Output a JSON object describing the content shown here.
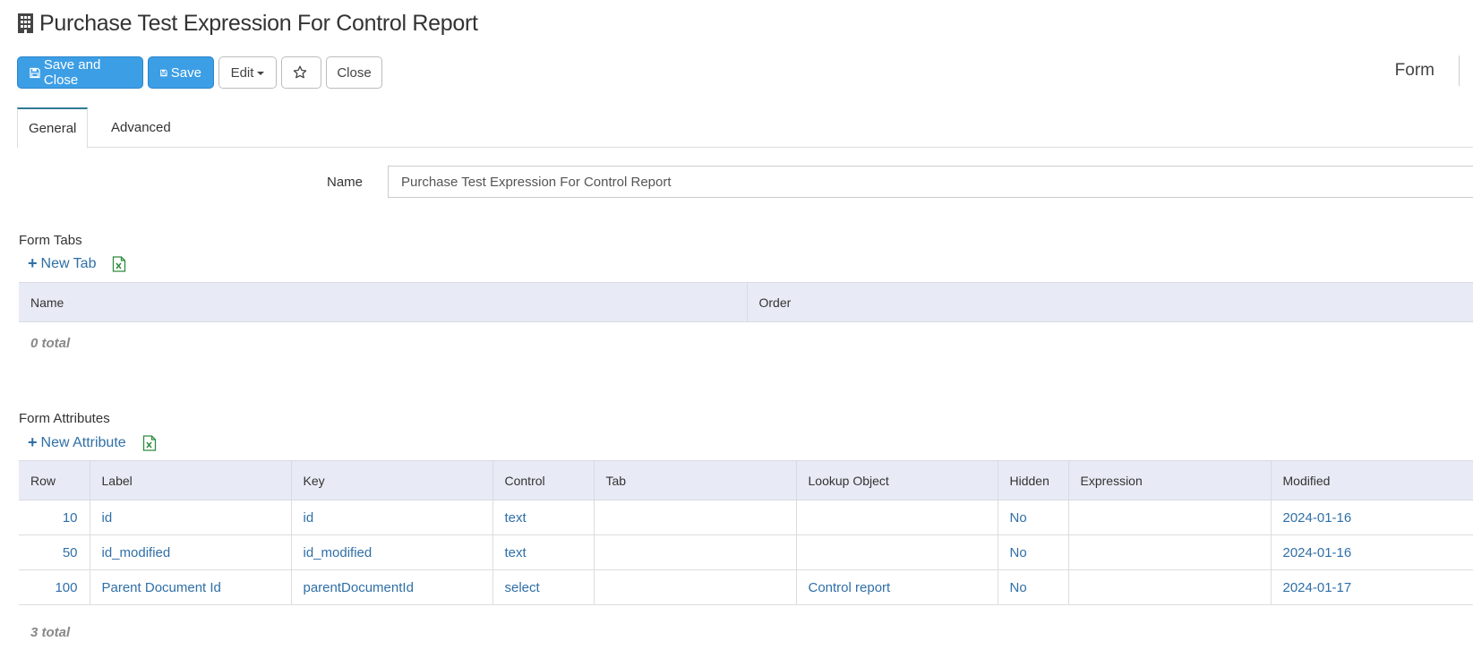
{
  "page": {
    "title": "Purchase Test Expression For Control Report",
    "title_icon": "building-icon"
  },
  "toolbar": {
    "save_close_label": "Save and Close",
    "save_label": "Save",
    "edit_label": "Edit",
    "favorite_icon": "star-icon",
    "close_label": "Close"
  },
  "header_right": {
    "label": "Form"
  },
  "tabs": [
    {
      "label": "General",
      "active": true
    },
    {
      "label": "Advanced",
      "active": false
    }
  ],
  "form": {
    "name_label": "Name",
    "name_value": "Purchase Test Expression For Control Report"
  },
  "form_tabs": {
    "title": "Form Tabs",
    "new_label": "New Tab",
    "columns": [
      "Name",
      "Order"
    ],
    "rows": [],
    "total": "0 total"
  },
  "form_attributes": {
    "title": "Form Attributes",
    "new_label": "New Attribute",
    "columns": [
      "Row",
      "Label",
      "Key",
      "Control",
      "Tab",
      "Lookup Object",
      "Hidden",
      "Expression",
      "Modified"
    ],
    "rows": [
      [
        "10",
        "id",
        "id",
        "text",
        "",
        "",
        "No",
        "",
        "2024-01-16"
      ],
      [
        "50",
        "id_modified",
        "id_modified",
        "text",
        "",
        "",
        "No",
        "",
        "2024-01-16"
      ],
      [
        "100",
        "Parent Document Id",
        "parentDocumentId",
        "select",
        "",
        "Control report",
        "No",
        "",
        "2024-01-17"
      ]
    ],
    "total": "3 total"
  },
  "colors": {
    "primary": "#3c9ee5",
    "link": "#2f6fa7",
    "header_bg": "#e8ebf5",
    "tab_accent": "#2f7a94",
    "excel": "#2e8b3d"
  }
}
